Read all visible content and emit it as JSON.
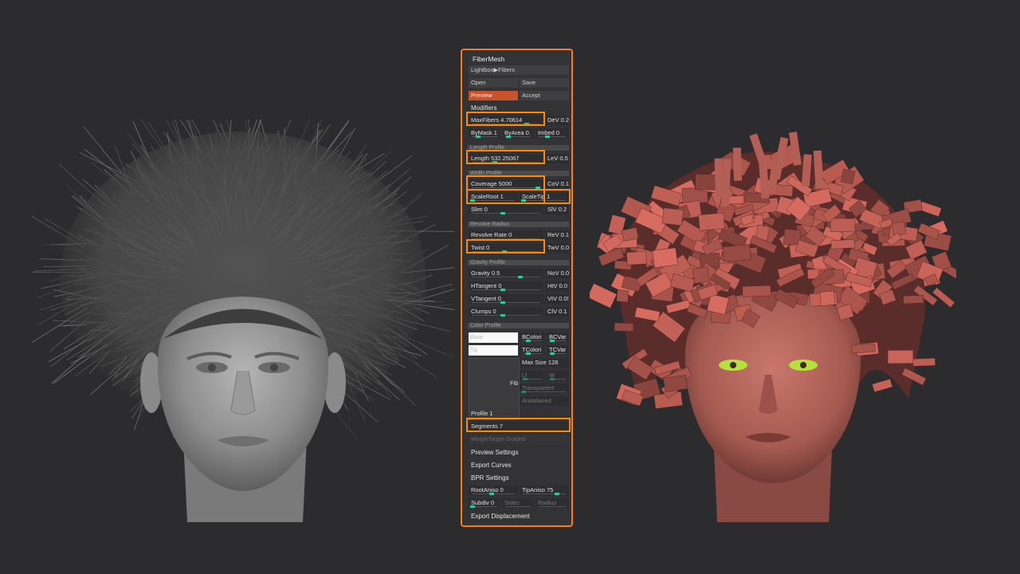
{
  "panel": {
    "title": "FiberMesh",
    "lightbox": "Lightbox▶Fibers",
    "open": "Open",
    "save": "Save",
    "preview": "Preview",
    "accept": "Accept",
    "modifiers": "Modifiers",
    "max_fibers": "MaxFibers 4.70614",
    "dev": "DeV 0.2",
    "bymask": "ByMask 1",
    "byarea": "ByArea 0.",
    "imbed": "Imbed 0",
    "length_profile": "Length Profile",
    "length": "Length 532.25067",
    "lev": "LeV 0.5",
    "width_profile": "Width Profile",
    "coverage": "Coverage 5000",
    "cov": "CoV 0.1",
    "scaleroot": "ScaleRoot 1",
    "scaletip": "ScaleTip 1",
    "slim": "Slim 0",
    "slv": "SlV 0.2",
    "revolve_radius": "Revolve Radius",
    "revolve_rate": "Revolve Rate 0",
    "rev": "ReV 0.1",
    "twist": "Twist 0",
    "twv": "TwV 0.0",
    "gravity_profile": "Gravity Profile",
    "gravity": "Gravity 0.5",
    "nov": "NoV 0.0",
    "htangent": "HTangent 0",
    "htv": "HtV 0.0",
    "vtangent": "VTangent 0",
    "vtv": "VtV 0.0!",
    "clumps": "Clumps 0",
    "clv": "ClV 0.1",
    "color_profile": "Color Profile",
    "base_placeholder": "Base",
    "tip_placeholder": "Tip",
    "bcolori": "BColori",
    "bcvar": "BCVar",
    "tcolori": "TColori",
    "tcvar": "TCVar",
    "max_size": "Max Size 128",
    "lf": "Lf",
    "w": "W",
    "transparent": "Transparent",
    "antialiased": "Antialiased",
    "fib": "Fib",
    "profile": "Profile 1",
    "segments": "Segments 7",
    "morph_target": "MorphTarget Guided",
    "preview_settings": "Preview Settings",
    "export_curves": "Export Curves",
    "bpr_settings": "BPR Settings",
    "rootaniso": "RootAniso 0",
    "tipaniso": "TipAniso 75",
    "subdiv": "Subdiv 0",
    "sides": "Sides",
    "radius": "Radius",
    "export_displacement": "Export Displacement"
  },
  "colors": {
    "highlight": "#ff8a00",
    "preview_active": "#c8532a",
    "slider_knob": "#2fc79b",
    "background": "#2c2b2d"
  }
}
